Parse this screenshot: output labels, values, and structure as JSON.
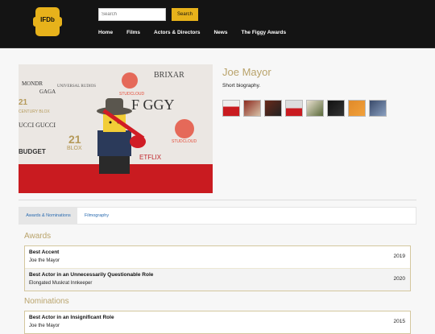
{
  "brand": {
    "logo_text": "IFDb",
    "accent": "#e7b21b"
  },
  "search": {
    "placeholder": "Search",
    "button_label": "Search"
  },
  "nav": {
    "home": "Home",
    "films": "Films",
    "actors": "Actors & Directors",
    "news": "News",
    "awards": "The Figgy Awards"
  },
  "profile": {
    "name": "Joe Mayor",
    "bio": "Short biography.",
    "photo_alt": "LEGO minifigure with cowboy hat and red guitar on red carpet",
    "thumbnails": [
      "thumb-1",
      "thumb-2",
      "thumb-3",
      "thumb-4",
      "thumb-5",
      "thumb-6",
      "thumb-7",
      "thumb-8"
    ]
  },
  "tabs": {
    "awards": "Awards & Nominations",
    "filmography": "Filmography"
  },
  "awards": {
    "title": "Awards",
    "items": [
      {
        "category": "Best Accent",
        "film": "Joe the Mayor",
        "year": "2019"
      },
      {
        "category": "Best Actor in an Unnecessarily Questionable Role",
        "film": "Elongated Muskrat Innkeeper",
        "year": "2020"
      }
    ]
  },
  "nominations": {
    "title": "Nominations",
    "items": [
      {
        "category": "Best Actor in an Insignificant Role",
        "film": "Joe the Mayor",
        "year": "2015"
      }
    ]
  }
}
